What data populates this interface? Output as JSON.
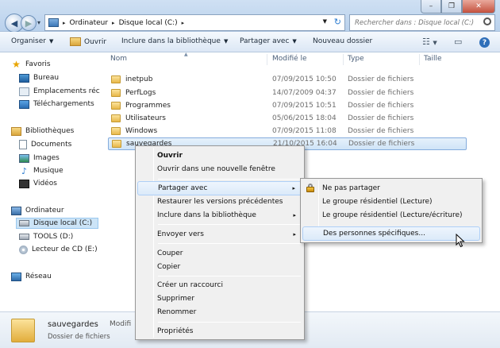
{
  "window": {
    "controls": {
      "minimize": "–",
      "maximize": "❐",
      "close": "✕"
    }
  },
  "address": {
    "crumbs": [
      "Ordinateur",
      "Disque local (C:)"
    ],
    "separator": "▸"
  },
  "search": {
    "placeholder": "Rechercher dans : Disque local (C:)"
  },
  "toolbar": {
    "organize": "Organiser",
    "open": "Ouvrir",
    "include_library": "Inclure dans la bibliothèque",
    "share_with": "Partager avec",
    "new_folder": "Nouveau dossier",
    "caret": "▼",
    "help": "?"
  },
  "nav": {
    "favorites": "Favoris",
    "desktop": "Bureau",
    "places": "Emplacements récen",
    "downloads": "Téléchargements",
    "libraries": "Bibliothèques",
    "documents": "Documents",
    "images": "Images",
    "music": "Musique",
    "videos": "Vidéos",
    "computer": "Ordinateur",
    "local_disk": "Disque local (C:)",
    "tools": "TOOLS (D:)",
    "cd_drive": "Lecteur de CD (E:) C",
    "network": "Réseau"
  },
  "columns": {
    "name": "Nom",
    "modified": "Modifié le",
    "type": "Type",
    "size": "Taille"
  },
  "files": [
    {
      "name": "inetpub",
      "date": "07/09/2015 10:50",
      "type": "Dossier de fichiers"
    },
    {
      "name": "PerfLogs",
      "date": "14/07/2009 04:37",
      "type": "Dossier de fichiers"
    },
    {
      "name": "Programmes",
      "date": "07/09/2015 10:51",
      "type": "Dossier de fichiers"
    },
    {
      "name": "Utilisateurs",
      "date": "05/06/2015 18:04",
      "type": "Dossier de fichiers"
    },
    {
      "name": "Windows",
      "date": "07/09/2015 11:08",
      "type": "Dossier de fichiers"
    },
    {
      "name": "sauvegardes",
      "date": "21/10/2015 16:04",
      "type": "Dossier de fichiers"
    }
  ],
  "context_menu": {
    "open": "Ouvrir",
    "open_new_window": "Ouvrir dans une nouvelle fenêtre",
    "share_with": "Partager avec",
    "restore_versions": "Restaurer les versions précédentes",
    "include_library": "Inclure dans la bibliothèque",
    "send_to": "Envoyer vers",
    "cut": "Couper",
    "copy": "Copier",
    "create_shortcut": "Créer un raccourci",
    "delete": "Supprimer",
    "rename": "Renommer",
    "properties": "Propriétés",
    "arrow": "▸"
  },
  "share_submenu": {
    "no_share": "Ne pas partager",
    "homegroup_read": "Le groupe résidentiel (Lecture)",
    "homegroup_readwrite": "Le groupe résidentiel (Lecture/écriture)",
    "specific_people": "Des personnes spécifiques..."
  },
  "details": {
    "name": "sauvegardes",
    "type": "Dossier de fichiers",
    "modified_label": "Modifi"
  }
}
